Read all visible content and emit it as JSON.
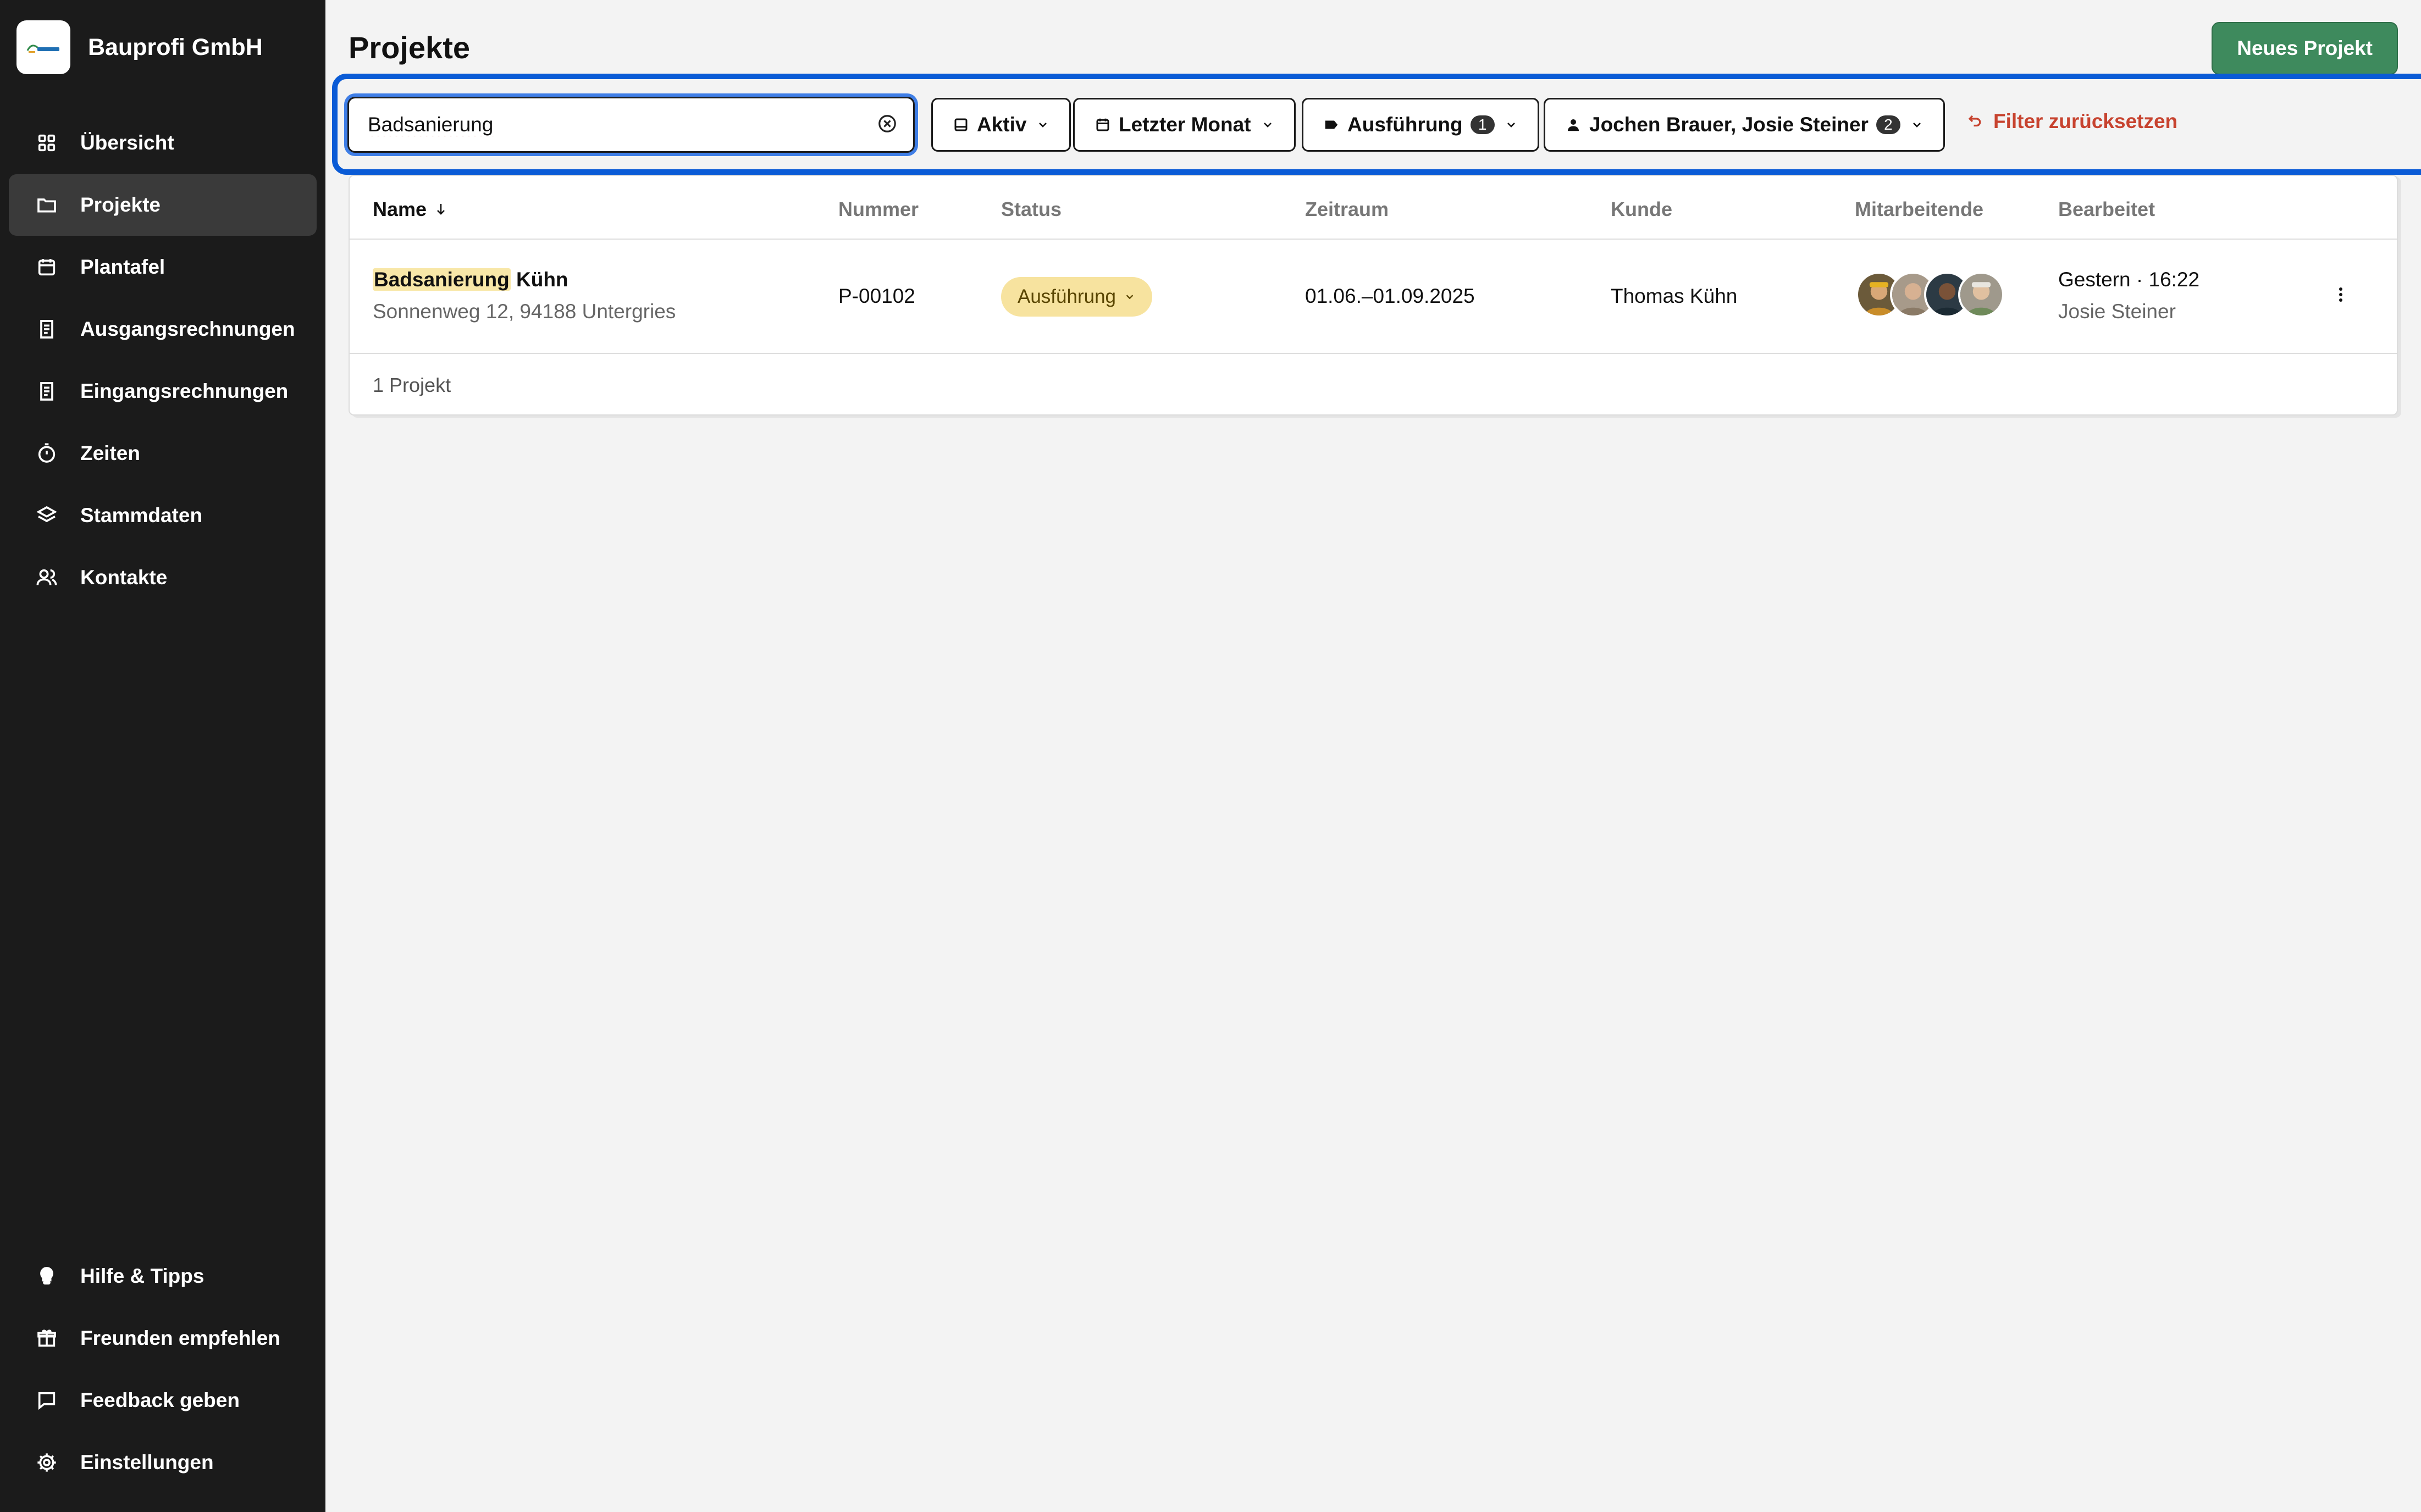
{
  "brand": {
    "name": "Bauprofi GmbH",
    "logo_icon": "bauprofi-logo"
  },
  "sidebar": {
    "items": [
      {
        "label": "Übersicht",
        "icon": "grid-icon",
        "active": false
      },
      {
        "label": "Projekte",
        "icon": "folder-icon",
        "active": true
      },
      {
        "label": "Plantafel",
        "icon": "calendar-icon",
        "active": false
      },
      {
        "label": "Ausgangsrechnungen",
        "icon": "invoice-icon",
        "active": false
      },
      {
        "label": "Eingangsrechnungen",
        "icon": "invoice-icon",
        "active": false
      },
      {
        "label": "Zeiten",
        "icon": "stopwatch-icon",
        "active": false
      },
      {
        "label": "Stammdaten",
        "icon": "layers-icon",
        "active": false
      },
      {
        "label": "Kontakte",
        "icon": "users-icon",
        "active": false
      }
    ],
    "bottom_items": [
      {
        "label": "Hilfe & Tipps",
        "icon": "lightbulb-icon"
      },
      {
        "label": "Freunden empfehlen",
        "icon": "gift-icon"
      },
      {
        "label": "Feedback geben",
        "icon": "message-icon"
      },
      {
        "label": "Einstellungen",
        "icon": "gear-icon"
      }
    ]
  },
  "header": {
    "title": "Projekte",
    "new_project_label": "Neues Projekt"
  },
  "filters": {
    "search_value": "Badsanierung",
    "state_label": "Aktiv",
    "period_label": "Letzter Monat",
    "status_label": "Ausführung",
    "status_count": "1",
    "employees_label": "Jochen Brauer, Josie Steiner",
    "employees_count": "2",
    "reset_label": "Filter zurücksetzen"
  },
  "table": {
    "columns": {
      "name": "Name",
      "number": "Nummer",
      "status": "Status",
      "period": "Zeitraum",
      "customer": "Kunde",
      "employees": "Mitarbeitende",
      "edited": "Bearbeitet"
    },
    "rows": [
      {
        "name_highlight": "Badsanierung",
        "name_rest": " Kühn",
        "address": "Sonnenweg 12, 94188 Untergries",
        "number": "P-00102",
        "status": "Ausführung",
        "period": "01.06.–01.09.2025",
        "customer": "Thomas Kühn",
        "edited_time": "Gestern · 16:22",
        "edited_by": "Josie Steiner"
      }
    ],
    "footer_count": "1 Projekt"
  },
  "colors": {
    "sidebar_bg": "#1b1b1b",
    "accent_green": "#3e8a5d",
    "focus_blue": "#0a5bd6",
    "status_yellow": "#f7e39f",
    "reset_red": "#c7432f"
  }
}
